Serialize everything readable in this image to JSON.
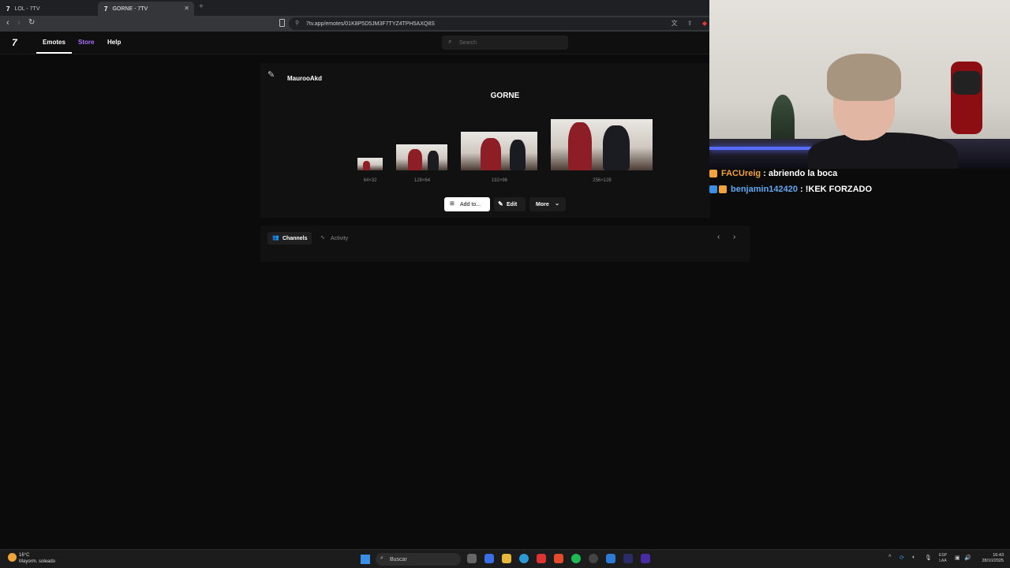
{
  "browser": {
    "tabs": [
      {
        "label": "LOL - 7TV",
        "favicon": "7tv-logo"
      },
      {
        "label": "GORNE - 7TV",
        "favicon": "7tv-logo",
        "active": true
      }
    ],
    "url": "7tv.app/emotes/01K8P5D5JM3F7TYZ4TPH5AXQ8S"
  },
  "site": {
    "logo": "7",
    "nav": [
      "Emotes",
      "Store",
      "Help"
    ],
    "accent": "#a970ff",
    "search_placeholder": "Search"
  },
  "emote": {
    "owner": "MaurooAkd",
    "name": "GORNE",
    "sizes": [
      "64×32",
      "128×64",
      "192×96",
      "256×128"
    ],
    "actions": {
      "add": "Add to...",
      "edit": "Edit",
      "more": "More"
    }
  },
  "tabs_section": {
    "tabs": [
      "Channels",
      "Activity"
    ]
  },
  "chat": [
    {
      "user": "FACUreig",
      "message": ": abriendo la boca",
      "color": "#f2a33a"
    },
    {
      "user": "benjamin142420",
      "message": ": !KEK FORZADO",
      "color": "#5fa8f2"
    }
  ],
  "taskbar": {
    "weather_temp": "16°C",
    "weather_desc": "Mayorm. soleado",
    "search_label": "Buscar",
    "lang_line1": "ESP",
    "lang_line2": "LAA",
    "time": "16:43",
    "date": "28/10/2025"
  }
}
